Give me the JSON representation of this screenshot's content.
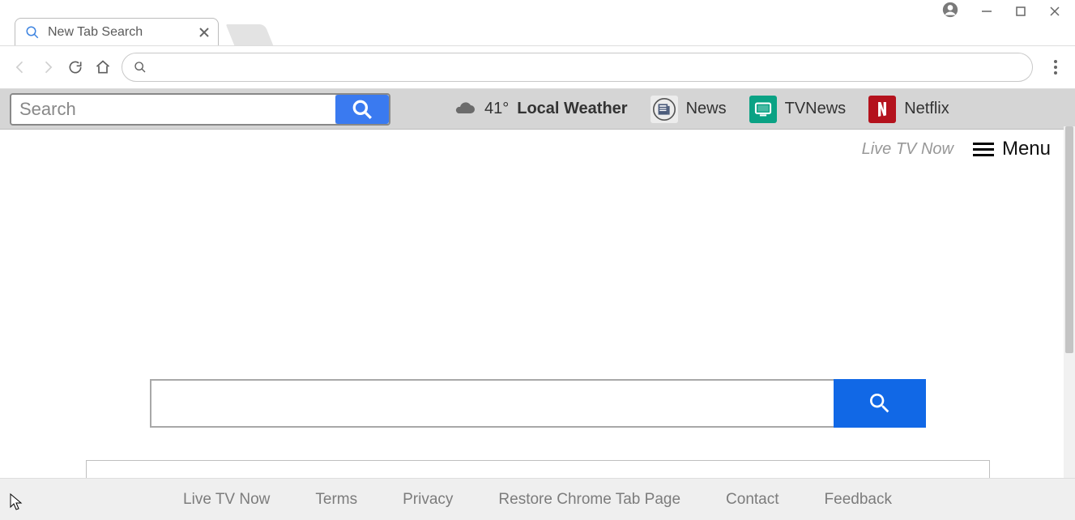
{
  "window": {
    "tab_title": "New Tab Search"
  },
  "omnibox": {
    "value": ""
  },
  "toolbar": {
    "search_placeholder": "Search",
    "search_value": "",
    "weather": {
      "temp": "41°",
      "label": "Local Weather"
    },
    "links": {
      "news": "News",
      "tvnews": "TVNews",
      "netflix": "Netflix"
    }
  },
  "page": {
    "live_tv_now": "Live TV Now",
    "menu_label": "Menu",
    "center_search_value": ""
  },
  "footer": {
    "items": [
      "Live TV Now",
      "Terms",
      "Privacy",
      "Restore Chrome Tab Page",
      "Contact",
      "Feedback"
    ]
  }
}
